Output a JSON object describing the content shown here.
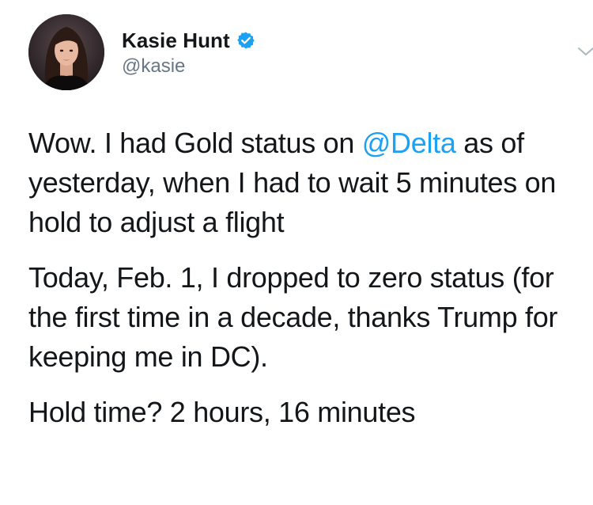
{
  "author": {
    "display_name": "Kasie Hunt",
    "handle": "@kasie",
    "verified": true,
    "avatar_icon": "profile-photo",
    "verified_icon": "verified-badge-icon"
  },
  "menu": {
    "icon": "chevron-down-icon"
  },
  "tweet": {
    "line1_before": "Wow. I had Gold status on ",
    "line1_mention": "@Delta",
    "line1_after": " as of yesterday, when I had to wait 5 minutes on hold to adjust a flight",
    "paragraph2": "Today, Feb. 1, I dropped to zero status (for the first time in a decade, thanks Trump for keeping me in DC).",
    "paragraph3": "Hold time? 2 hours, 16 minutes"
  },
  "colors": {
    "link": "#1da1f2",
    "verified": "#1da1f2",
    "secondary_text": "#657786",
    "primary_text": "#14171a"
  }
}
